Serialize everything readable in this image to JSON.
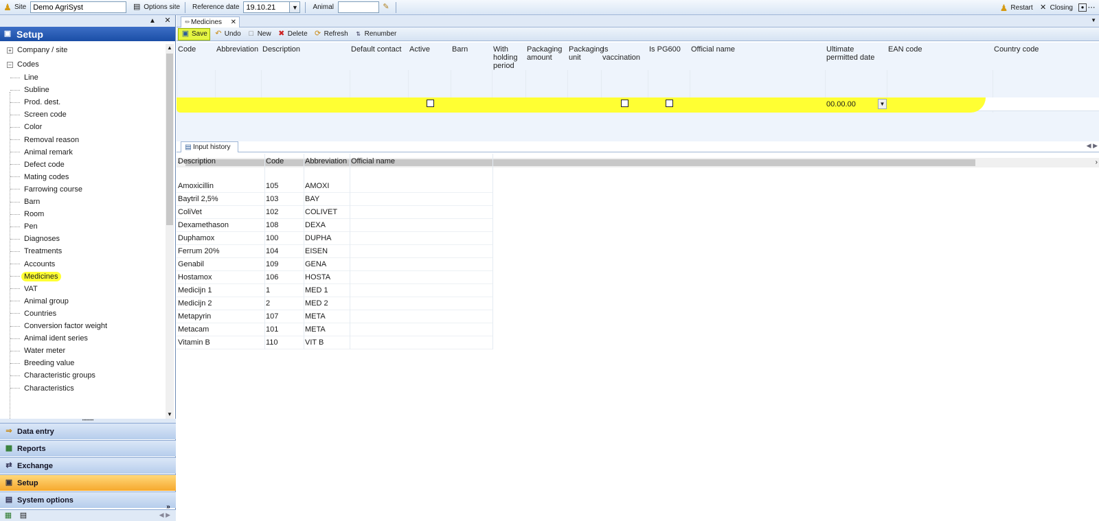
{
  "topbar": {
    "site_label": "Site",
    "site_value": "Demo AgriSyst",
    "options_site": "Options site",
    "reference_date_label": "Reference date",
    "reference_date_value": "19.10.21",
    "animal_label": "Animal",
    "animal_value": "",
    "restart": "Restart",
    "closing": "Closing"
  },
  "sidebar": {
    "title": "Setup",
    "groups": [
      {
        "label": "Company / site",
        "expanded": false
      },
      {
        "label": "Codes",
        "expanded": true
      }
    ],
    "items": [
      "Line",
      "Subline",
      "Prod. dest.",
      "Screen code",
      "Color",
      "Removal reason",
      "Animal remark",
      "Defect code",
      "Mating codes",
      "Farrowing course",
      "Barn",
      "Room",
      "Pen",
      "Diagnoses",
      "Treatments",
      "Accounts",
      "Medicines",
      "VAT",
      "Animal group",
      "Countries",
      "Conversion factor weight",
      "Animal ident series",
      "Water meter",
      "Breeding value",
      "Characteristic groups",
      "Characteristics"
    ],
    "selected_item": "Medicines",
    "nav": [
      {
        "label": "Data entry",
        "active": false,
        "icon": "arrow-in-icon"
      },
      {
        "label": "Reports",
        "active": false,
        "icon": "report-icon"
      },
      {
        "label": "Exchange",
        "active": false,
        "icon": "exchange-icon"
      },
      {
        "label": "Setup",
        "active": true,
        "icon": "setup-icon"
      },
      {
        "label": "System options",
        "active": false,
        "icon": "system-icon"
      }
    ]
  },
  "document": {
    "tab_label": "Medicines",
    "toolbar": {
      "save": "Save",
      "undo": "Undo",
      "new": "New",
      "delete": "Delete",
      "refresh": "Refresh",
      "renumber": "Renumber"
    },
    "columns": [
      "Code",
      "Abbreviation",
      "Description",
      "Default contact",
      "Active",
      "Barn",
      "With holding period",
      "Packaging amount",
      "Packaging unit",
      "Is vaccination",
      "Is PG600",
      "Official name",
      "Ultimate permitted date",
      "EAN code",
      "Country code"
    ],
    "new_row": {
      "ultimate_permitted_date": "00.00.00"
    }
  },
  "history": {
    "tab_label": "Input history",
    "columns": [
      "Description",
      "Code",
      "Abbreviation",
      "Official name"
    ],
    "rows": [
      {
        "description": "Amoxicillin",
        "code": "105",
        "abbreviation": "AMOXI",
        "official": ""
      },
      {
        "description": "Baytril 2,5%",
        "code": "103",
        "abbreviation": "BAY",
        "official": ""
      },
      {
        "description": "ColiVet",
        "code": "102",
        "abbreviation": "COLIVET",
        "official": ""
      },
      {
        "description": "Dexamethason",
        "code": "108",
        "abbreviation": "DEXA",
        "official": ""
      },
      {
        "description": "Duphamox",
        "code": "100",
        "abbreviation": "DUPHA",
        "official": ""
      },
      {
        "description": "Ferrum 20%",
        "code": "104",
        "abbreviation": "EISEN",
        "official": ""
      },
      {
        "description": "Genabil",
        "code": "109",
        "abbreviation": "GENA",
        "official": ""
      },
      {
        "description": "Hostamox",
        "code": "106",
        "abbreviation": "HOSTA",
        "official": ""
      },
      {
        "description": "Medicijn 1",
        "code": "1",
        "abbreviation": "MED 1",
        "official": ""
      },
      {
        "description": "Medicijn 2",
        "code": "2",
        "abbreviation": "MED 2",
        "official": ""
      },
      {
        "description": "Metapyrin",
        "code": "107",
        "abbreviation": "META",
        "official": ""
      },
      {
        "description": "Metacam",
        "code": "101",
        "abbreviation": "META",
        "official": ""
      },
      {
        "description": "Vitamin B",
        "code": "110",
        "abbreviation": "VIT B",
        "official": ""
      }
    ]
  },
  "colors": {
    "highlight": "#ffff33",
    "header_blue": "#1a4ea6",
    "active_nav": "#f6a92d"
  }
}
